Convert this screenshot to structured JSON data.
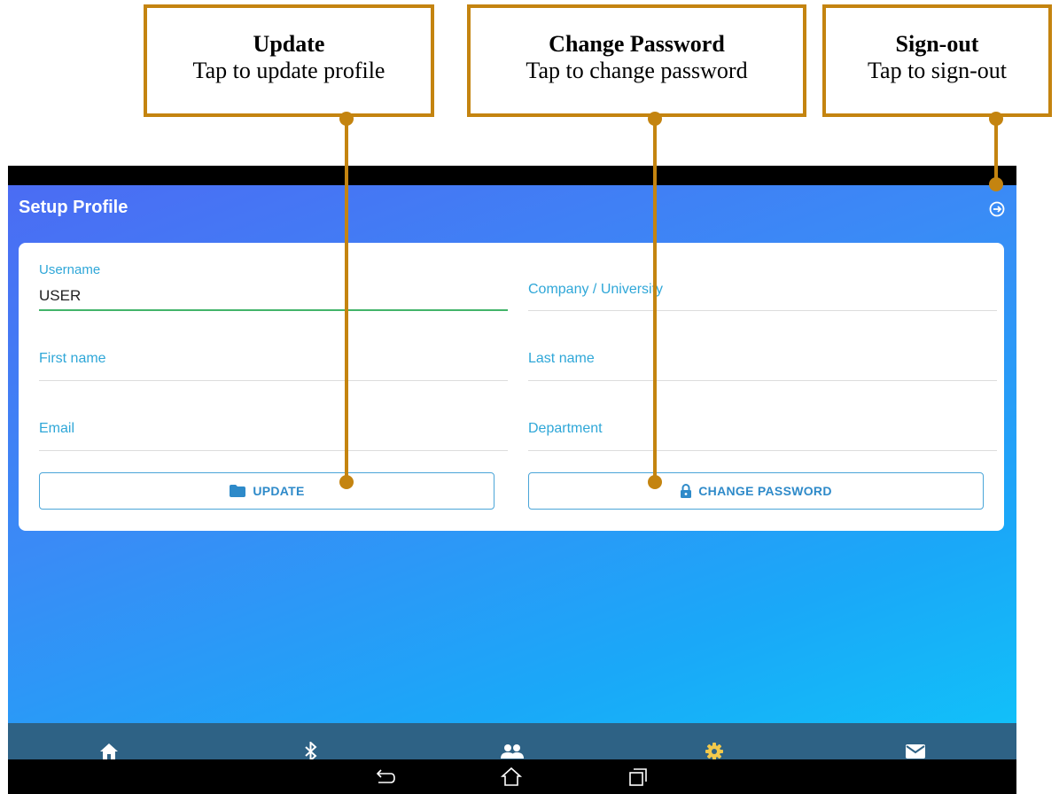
{
  "callouts": {
    "update": {
      "title": "Update",
      "desc": "Tap to update profile"
    },
    "change_password": {
      "title": "Change Password",
      "desc": "Tap to change password"
    },
    "signout": {
      "title": "Sign-out",
      "desc": "Tap to sign-out"
    }
  },
  "colors": {
    "callout": "#C48410",
    "accent_label": "#2fa7d8",
    "active_underline": "#43b46a",
    "tab_indicator": "#f2c94c"
  },
  "header": {
    "title": "Setup Profile",
    "signout_icon": "sign-out-icon"
  },
  "form": {
    "username": {
      "label": "Username",
      "value": "USER"
    },
    "company": {
      "label": "Company / University"
    },
    "first_name": {
      "label": "First name"
    },
    "last_name": {
      "label": "Last name"
    },
    "email": {
      "label": "Email"
    },
    "department": {
      "label": "Department"
    }
  },
  "buttons": {
    "update": {
      "label": "UPDATE",
      "icon": "folder-icon"
    },
    "change_password": {
      "label": "CHANGE PASSWORD",
      "icon": "lock-icon"
    }
  },
  "tabs": [
    {
      "icon": "home-icon"
    },
    {
      "icon": "bluetooth-icon"
    },
    {
      "icon": "people-icon"
    },
    {
      "icon": "gear-icon",
      "active": true
    },
    {
      "icon": "mail-icon"
    }
  ],
  "system_nav": [
    "back-icon",
    "home-outline-icon",
    "recent-apps-icon"
  ]
}
